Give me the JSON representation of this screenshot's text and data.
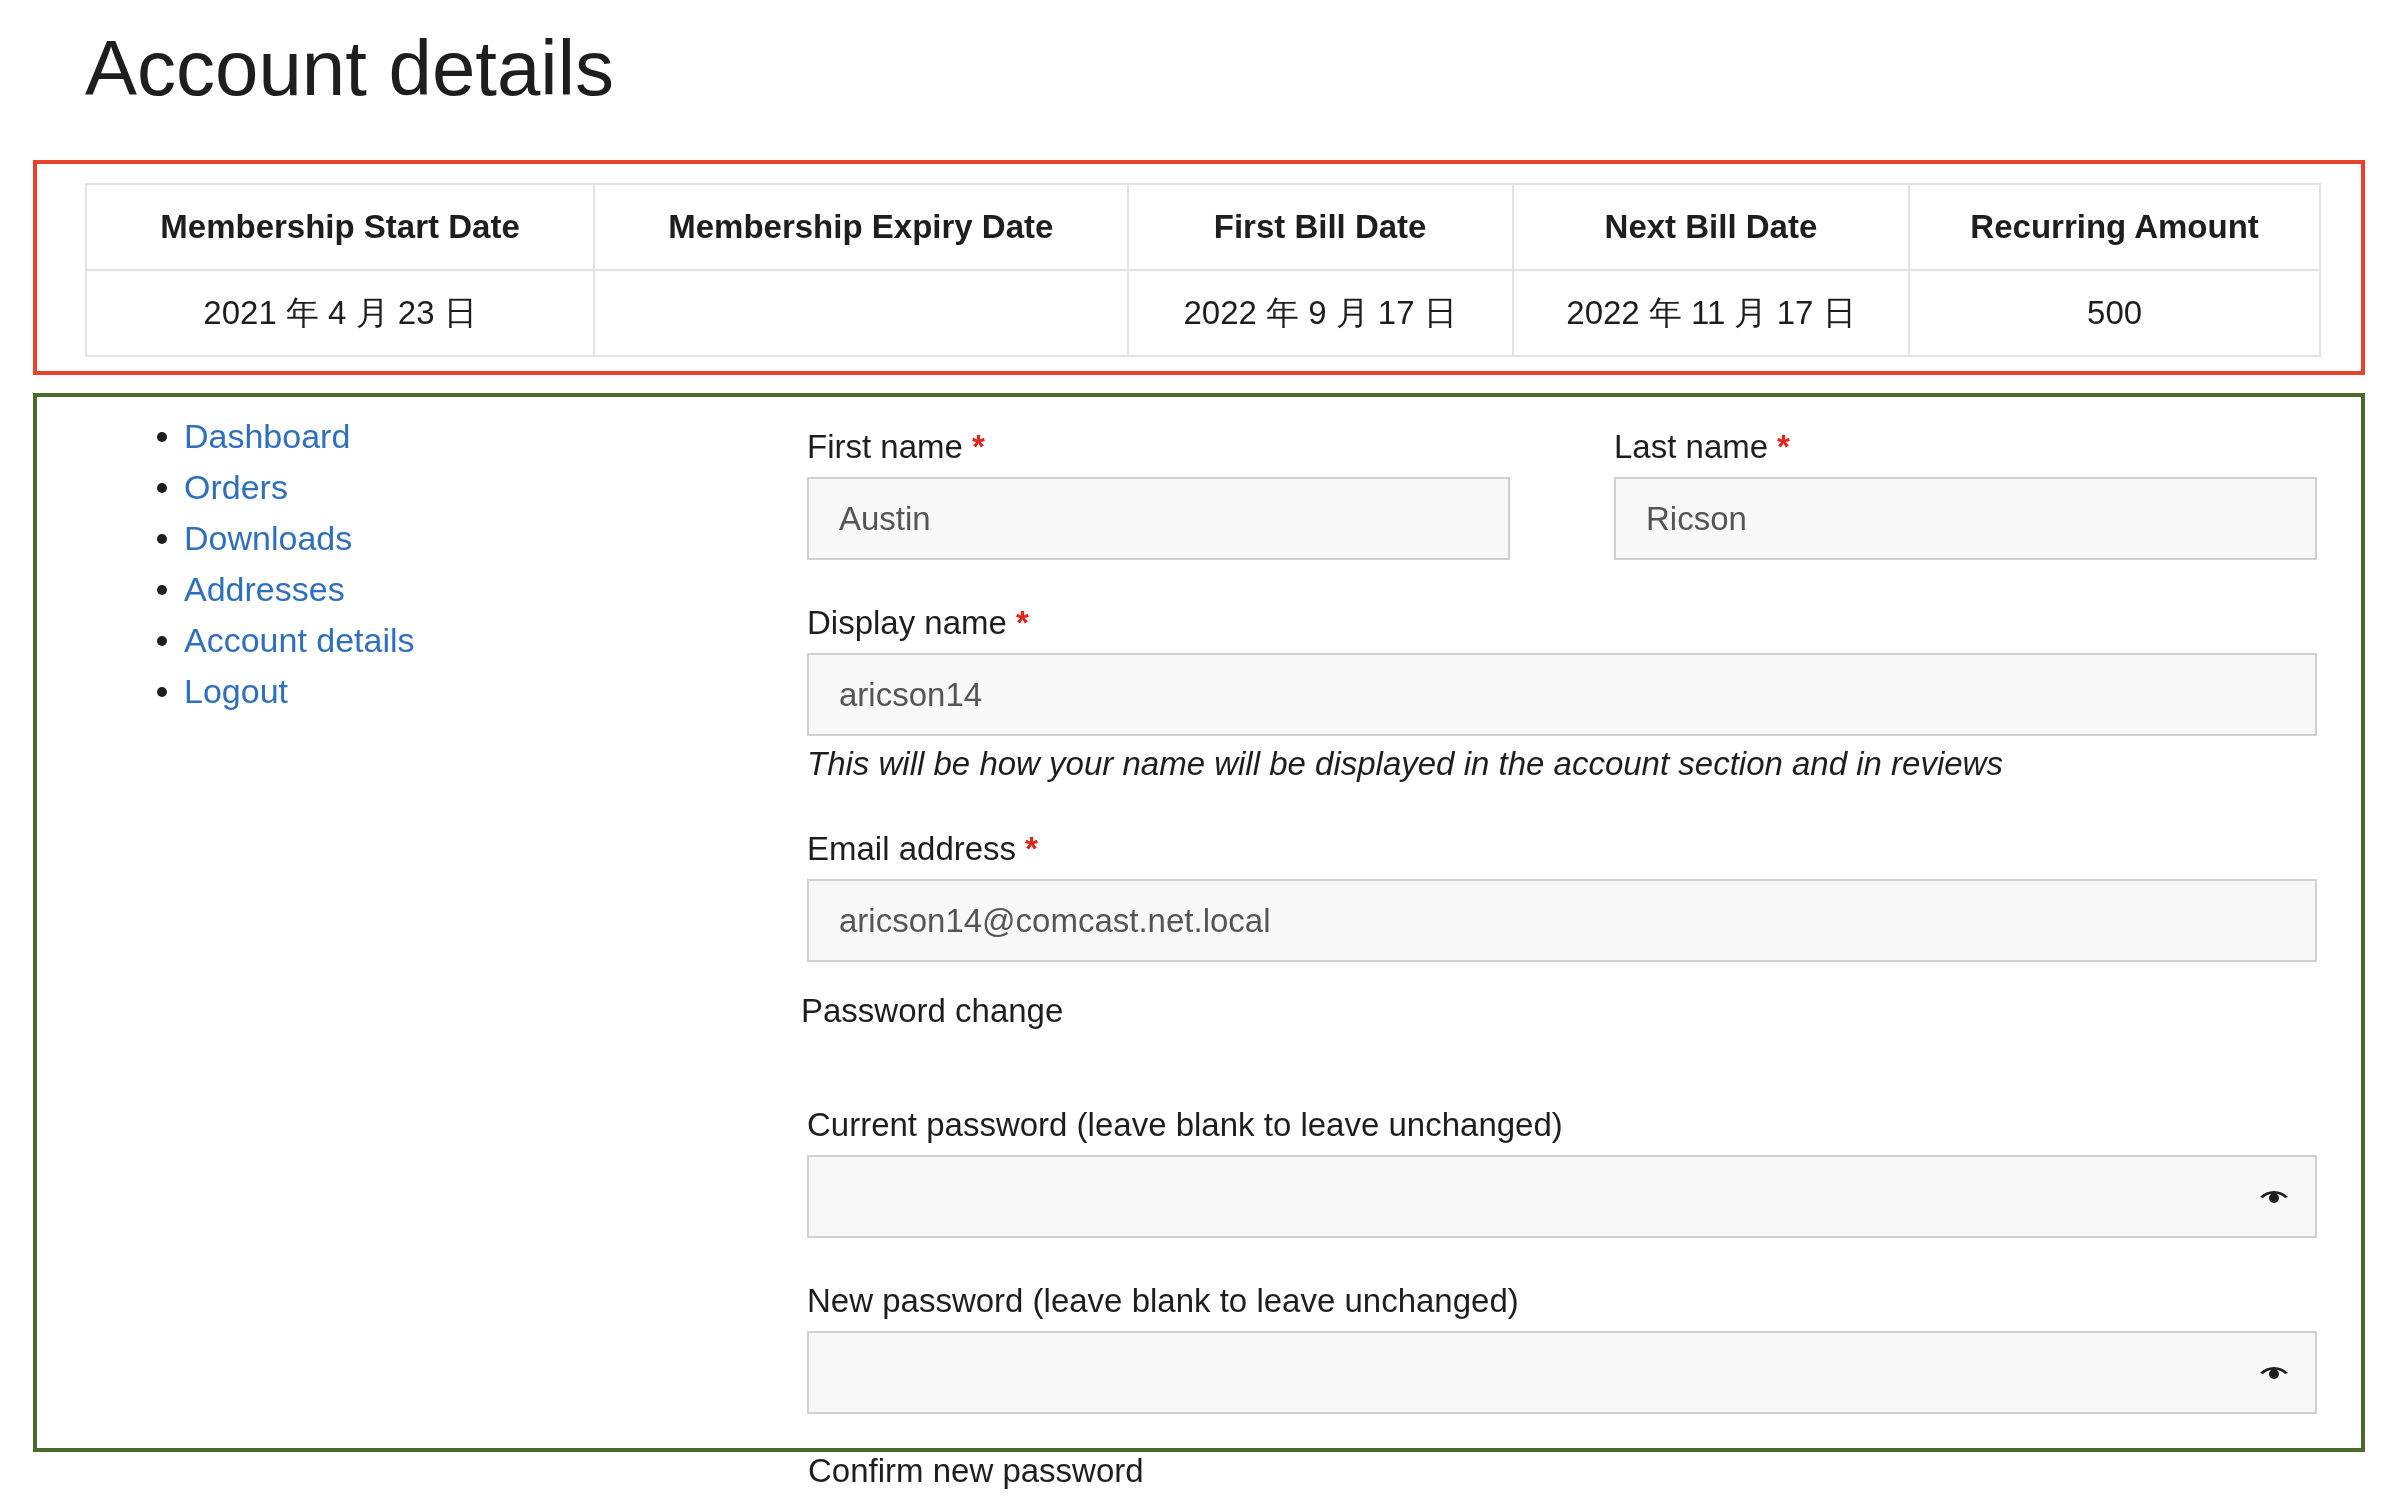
{
  "title": "Account details",
  "membership": {
    "color": "#e8432a",
    "columns": [
      "Membership Start Date",
      "Membership Expiry Date",
      "First Bill Date",
      "Next Bill Date",
      "Recurring Amount"
    ],
    "row": {
      "start_date": "2021 年 4 月 23 日",
      "first_bill_date": "2022 年 9 月 17 日",
      "next_bill_date": "2022 年 11 月 17 日",
      "recurring_amount": "500"
    }
  },
  "account": {
    "color": "#4c6a2c",
    "nav": [
      {
        "label": "Dashboard"
      },
      {
        "label": "Orders"
      },
      {
        "label": "Downloads"
      },
      {
        "label": "Addresses"
      },
      {
        "label": "Account details"
      },
      {
        "label": "Logout"
      }
    ],
    "form": [
      {
        "kind": "pair",
        "fields": [
          {
            "label": "First name",
            "required_mark": "*",
            "value": "Austin"
          },
          {
            "label": "Last name",
            "required_mark": "*",
            "value": "Ricson"
          }
        ]
      },
      {
        "kind": "text",
        "label": "Display name",
        "required_mark": "*",
        "value": "aricson14",
        "hint": "This will be how your name will be displayed in the account section and in reviews"
      },
      {
        "kind": "text",
        "label": "Email address",
        "required_mark": "*",
        "value": "aricson14@comcast.net.local"
      },
      {
        "kind": "heading",
        "label": "Password change"
      },
      {
        "kind": "password",
        "label": "Current password (leave blank to leave unchanged)"
      },
      {
        "kind": "password",
        "label": "New password (leave blank to leave unchanged)"
      }
    ]
  },
  "below": {
    "label": "Confirm new password"
  }
}
